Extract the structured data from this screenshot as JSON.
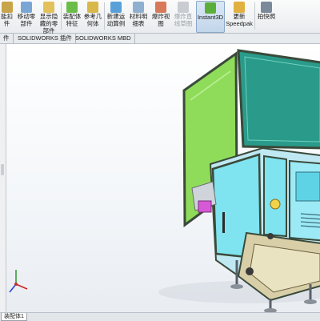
{
  "ribbon": {
    "items": [
      {
        "label": "能扣\n件"
      },
      {
        "label": "移动零\n部件"
      },
      {
        "label": "显示隐\n藏的零\n部件"
      },
      {
        "label": "装配体\n特征"
      },
      {
        "label": "参考几\n何体"
      },
      {
        "label": "新建运\n动算例"
      },
      {
        "label": "材料明\n细表"
      },
      {
        "label": "爆炸视\n图"
      },
      {
        "label": "爆炸直\n线草图"
      },
      {
        "label": "Instant3D"
      },
      {
        "label": "更新\nSpeedpak"
      },
      {
        "label": "拍快照"
      }
    ]
  },
  "tabs": [
    {
      "label": "件"
    },
    {
      "label": "SOLIDWORKS 插件"
    },
    {
      "label": "SOLIDWORKS MBD"
    }
  ],
  "status": {
    "sheet_tab": "装配体1"
  },
  "colors": {
    "panel_green": "#8fdc5a",
    "panel_teal": "#2a9b8a",
    "panel_cyan": "#7fe3f0",
    "frame": "#3a4a3a"
  }
}
